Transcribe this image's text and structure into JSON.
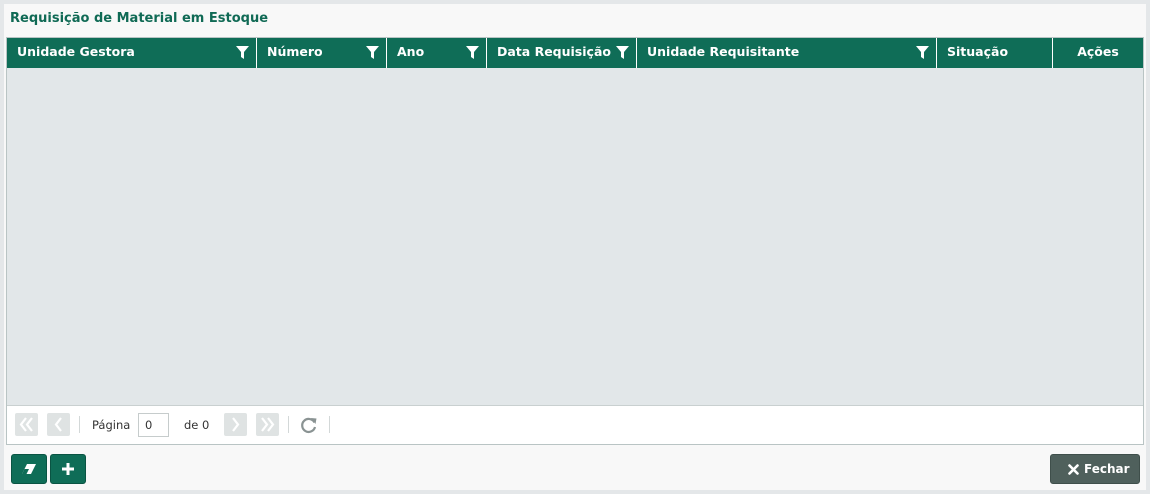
{
  "window": {
    "title": "Requisição de Material em Estoque"
  },
  "grid": {
    "columns": [
      {
        "label": "Unidade Gestora",
        "filterable": true
      },
      {
        "label": "Número",
        "filterable": true
      },
      {
        "label": "Ano",
        "filterable": true
      },
      {
        "label": "Data Requisição",
        "filterable": true
      },
      {
        "label": "Unidade Requisitante",
        "filterable": true
      },
      {
        "label": "Situação",
        "filterable": false
      },
      {
        "label": "Ações",
        "filterable": false
      }
    ],
    "rows": []
  },
  "pager": {
    "page_label": "Página",
    "page_value": "0",
    "of_label": "de 0",
    "icons": {
      "first": "double-chevron-left-icon",
      "prev": "chevron-left-icon",
      "next": "chevron-right-icon",
      "last": "double-chevron-right-icon",
      "refresh": "refresh-icon"
    }
  },
  "toolbar": {
    "clear_icon": "eraser-icon",
    "add_icon": "plus-icon",
    "close_label": "Fechar",
    "close_icon": "close-icon"
  },
  "colors": {
    "header_bg": "#0f6d57",
    "title_color": "#106a55",
    "close_button_bg": "#4f605c",
    "grid_body_bg": "#e2e7e9"
  }
}
